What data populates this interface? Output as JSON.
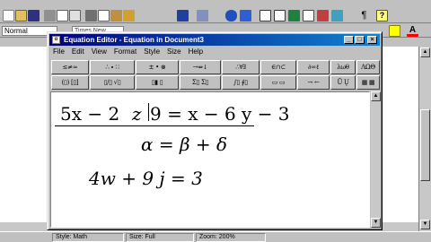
{
  "word": {
    "style_box": "Normal",
    "font_box": "Times New Roman",
    "toolbar_icons": [
      "new-icon",
      "open-icon",
      "save-icon",
      "print-icon",
      "preview-icon",
      "spelling-icon",
      "cut-icon",
      "copy-icon",
      "paste-icon",
      "format-painter-icon",
      "undo-icon",
      "redo-icon",
      "hyperlink-icon",
      "web-icon",
      "tables-icon",
      "insert-table-icon",
      "excel-icon",
      "columns-icon",
      "drawing-icon",
      "map-icon",
      "show-hide-icon",
      "help-icon"
    ],
    "status": {
      "style": "Style: Math",
      "size": "Size: Full",
      "zoom": "Zoom: 200%"
    },
    "colors": {
      "highlight": "#ffff00",
      "font_color": "#ff0000"
    }
  },
  "equation_editor": {
    "title": "Equation Editor - Equation in Document3",
    "menu": [
      "File",
      "Edit",
      "View",
      "Format",
      "Style",
      "Size",
      "Help"
    ],
    "palette_row1": [
      "≤≠≈",
      "∴ ∙  ∷",
      "± • ⊗",
      "→⇔↓",
      "∴∀∃",
      "∈∩⊂",
      "∂∞ℓ",
      "λωθ",
      "ΛΩΘ"
    ],
    "palette_row2": [
      "(▯) [▯]",
      "▯/▯ √▯",
      "▯▮ ▯",
      "Σ▯ Σ▯",
      "∫▯ ∮▯",
      "▭ ▭",
      "→ ←",
      "Ū Ų",
      "▦ ▦"
    ],
    "equations": {
      "line1_left": "5x − 2",
      "line1_mid": "z",
      "line1_right": "9 = x − 6 y − 3",
      "line2": "α = β + δ",
      "line3": "4w + 9 j = 3"
    }
  }
}
